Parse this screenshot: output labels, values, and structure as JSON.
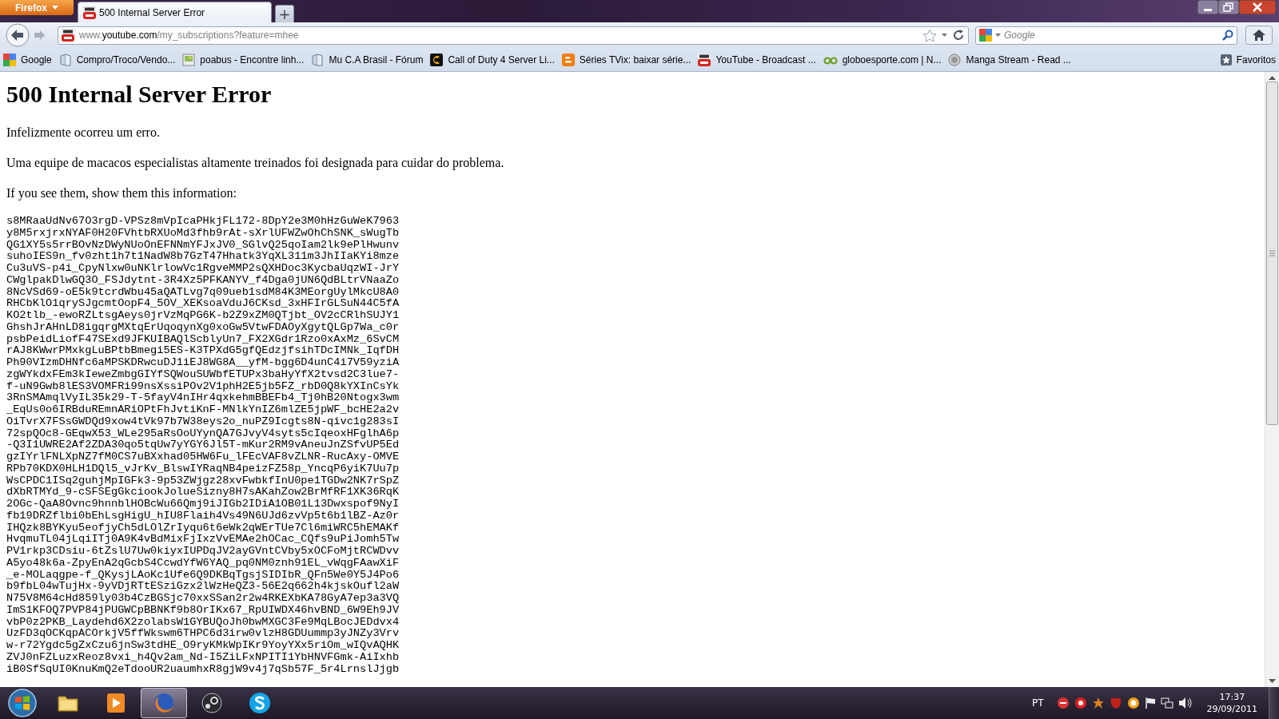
{
  "window": {
    "app_button": "Firefox",
    "tabs": [
      {
        "title": "500 Internal Server Error",
        "kind": "youtube",
        "selected": true
      }
    ],
    "new_tab": "+"
  },
  "navbar": {
    "url_prefix": "www.",
    "url_domain": "youtube.com",
    "url_path": "/my_subscriptions?feature=mhee",
    "search_placeholder": "Google"
  },
  "bookmarks": [
    {
      "label": "Google",
      "kind": "google"
    },
    {
      "label": "Compro/Troco/Vendo...",
      "kind": "page"
    },
    {
      "label": "poabus - Encontre linh...",
      "kind": "image"
    },
    {
      "label": "Mu C.A Brasil - Fórum",
      "kind": "page"
    },
    {
      "label": "Call of Duty 4 Server Li...",
      "kind": "cod"
    },
    {
      "label": "Séries TVix: baixar série...",
      "kind": "blogger"
    },
    {
      "label": "YouTube - Broadcast ...",
      "kind": "youtube"
    },
    {
      "label": "globoesporte.com | N...",
      "kind": "ge"
    },
    {
      "label": "Manga Stream - Read ...",
      "kind": "manga"
    }
  ],
  "bookmarks_menu": "Favoritos",
  "page": {
    "title": "500 Internal Server Error",
    "paragraphs": [
      "Infelizmente ocorreu um erro.",
      "Uma equipe de macacos especialistas altamente treinados foi designada para cuidar do problema.",
      "If you see them, show them this information:"
    ],
    "debug_lines": [
      "s8MRaaUdNv67O3rgD-VPSz8mVpIcaPHkjFL172-8DpY2e3M0hHzGuWeK7963",
      "y8M5rxjrxNYAF0H20FVhtbRXUoMd3fhb9rAt-sXrlUFWZwOhChSNK_sWugTb",
      "QG1XY5s5rrBOvNzDWyNUoOnEFNNmYFJxJV0_SGlvQ25qoIam2lk9ePlHwunv",
      "suhoIES9n_fv0zht1h7t1NadW8b7GzT47Hhatk3YqXL311m3JhIIaKYi8mze",
      "Cu3uVS-p4i_CpyNlxw0uNKlrlowVc1RgveMMP2sQXHDoc3KycbaUqzWI-JrY",
      "CWglpakDlwGQ3O_FSJdytnt-3R4Xz5PFKANYV_f4Dga0jUN6QdBLtrVNaaZo",
      "8NcVSd69-oE5k9tcrdWbu45aQATLvg7q09ueb1sdM84K3MEorgUylMkcU8A0",
      "RHCbKlO1qrySJgcmtOopF4_5OV_XEKsoaVduJ6CKsd_3xHFIrGLSuN44C5fA",
      "KO2tlb_-ewoRZLtsgAeys0jrVzMqPG6K-b2Z9xZM0QTjbt_OV2cCRlhSUJY1",
      "GhshJrAHnLD8igqrgMXtqErUqoqynXg0xoGw5VtwFDAOyXgytQLGp7Wa_c0r",
      "psbPeidLiofF47SExd9JFKUIBAQlScblyUn7_FX2XGdr1Rzo0xAxMz_6SvCM",
      "rAJ8KWwrPMxkgLuBPtbBmegi5ES-K3TPXdG5gfQEdzjfsihTDcIMNk_IqfDH",
      "Ph90VIzmDHNfc6aMPSKDRwcuDJ1iEJ8WG8A__yfM-bgg6D4unC4i7V59yziA",
      "zgWYkdxFEm3kIeweZmbgGIYfSQWouSUWbfETUPx3baHyYfX2tvsd2C3lue7-",
      "f-uN9Gwb8lES3VOMFRi99nsXssiPOv2V1phH2E5jb5FZ_rbD0Q8kYXInCsYk",
      "3RnSMAmqlVyIL35k29-T-5fayV4nIHr4qxkehmBBEFb4_Tj0hB20Ntogx3wm",
      "_EqUs0o6IRBduREmnARiOPtFhJvtiKnF-MNlkYnIZ6mlZE5jpWF_bcHE2a2v",
      "OiTvrX7FSsGWDQd9xow4tVk97b7W38eys2o_nuPZ9Icgts8N-qivc1g283sI",
      "72spQOc8-GEqwX53_WLe295aRsOoUYynQA7GJvyV4syts5cIqeoxHFglhA6p",
      "-Q3I1UWRE2Af2ZDA30qo5tqUw7yYGY6Jl5T-mKur2RM9vAneuJnZSfvUP5Ed",
      "gzIYrlFNLXpNZ7fM0CS7uBXxhad05HW6Fu_lFEcVAF8vZLNR-RucAxy-OMVE",
      "RPb70KDX0HLH1DQl5_vJrKv_BlswIYRaqNB4peizFZ58p_YncqP6yiK7Uu7p",
      "WsCPDC1ISq2guhjMpIGFk3-9p53ZWjgz28xvFwbkfInU0pe1TGDw2NK7rSpZ",
      "dXbRTMYd_9-cSFSEgGkciookJolueSizny8H7sAKahZow2BrMfRF1XK36RqK",
      "2OGc-QaA8Ovnc9hnnblHOBcWu66Qmj9iJIGb2IDiA1OB01L13Dwxspof9NyI",
      "fb19DRZflbi0bEhLsgHigU_hIU8Flaih4Vs49N6UJd6zvVp5t6b1lBZ-Az0r",
      "IHQzk8BYKyu5eofjyCh5dLOlZrIyqu6t6eWk2qWErTUe7Cl6miWRC5hEMAKf",
      "HvqmuTL04jLqiITj0A9K4vBdMixFjIxzVvEMAe2hOCac_CQfs9uPiJomh5Tw",
      "PV1rkp3CDsiu-6tZslU7Uw0kiyxIUPDqJV2ayGVntCVby5xOCFoMjtRCWDvv",
      "A5yo48k6a-ZpyEnA2qGcbS4CcwdYfW6YAQ_pq0NM0znh91EL_vWqgFAawXiF",
      "_e-MOLaqgpe-f_QKysjLAoKc1Ufe6Q9DKBqTgsjSIDIbR_QFn5We0Y5J4Po6",
      "b9fbL04wTujHx-9yVDjRTtESziGzx2lWzHeQZ3-56E2q662h4kjskOufl2aW",
      "N75V8M64cHd859ly03b4CzBGSjc70xxSSan2r2w4RKEXbKA78GyA7ep3a3VQ",
      "ImS1KFOQ7PVP84jPUGWCpBBNKf9b8OrIKx67_RpUIWDX46hvBND_6W9Eh9JV",
      "vbP0z2PKB_Laydehd6X2zolabsW1GYBUQoJh0bwMXGC3Fe9MqLBocJEDdvx4",
      "UzFD3qOCKqpACOrkjV5ffWkswm6THPC6d3irw0vlzH8GDUummp3yJNZy3Vrv",
      "w-r72Ygdc5gZxCzu6jnSw3tdHE_O9ryKMkWpIKr9YoyYXx5riOm_wIQvAQHK",
      "ZVJ0nFZLuzxReoz8vxi_h4Qv2am_Nd-I5ZiLFxNPITI1YbHNVFGmk-AiIxhb",
      "iB0SfSqUI0KnuKmQ2eTdooUR2uaumhxR8gjW9v4j7qSb57F_5r4LrnslJjgb"
    ]
  },
  "taskbar": {
    "apps": [
      {
        "kind": "explorer",
        "selected": false
      },
      {
        "kind": "media",
        "selected": false
      },
      {
        "kind": "firefox",
        "selected": true
      },
      {
        "kind": "steam",
        "selected": false
      },
      {
        "kind": "skype",
        "selected": false
      }
    ],
    "language": "PT",
    "time": "17:37",
    "date": "29/09/2011"
  }
}
